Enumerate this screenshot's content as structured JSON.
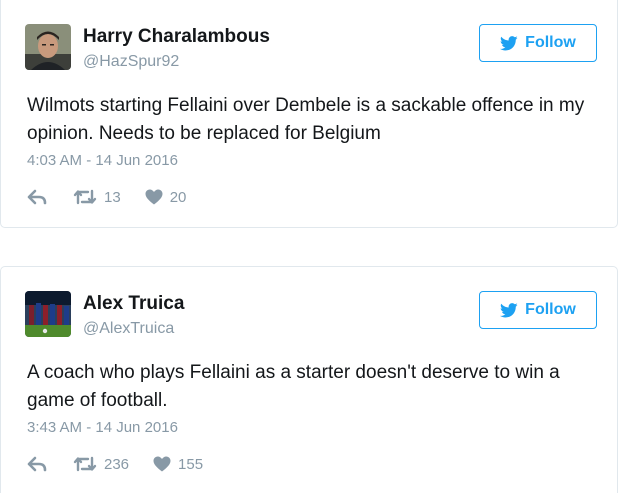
{
  "tweets": [
    {
      "name": "Harry Charalambous",
      "handle": "@HazSpur92",
      "follow_label": "Follow",
      "text": "Wilmots starting Fellaini over Dembele is a sackable offence in my opinion. Needs to be replaced for Belgium",
      "timestamp": "4:03 AM - 14 Jun 2016",
      "retweets": "13",
      "likes": "20",
      "avatar_icon": "profile-photo"
    },
    {
      "name": "Alex Truica",
      "handle": "@AlexTruica",
      "follow_label": "Follow",
      "text": "A coach who plays Fellaini as a starter doesn't deserve to win a game of football.",
      "timestamp": "3:43 AM - 14 Jun 2016",
      "retweets": "236",
      "likes": "155",
      "avatar_icon": "football-team-photo"
    }
  ],
  "colors": {
    "accent": "#1da1f2",
    "muted": "#8899a6",
    "text": "#14171a",
    "border": "#e1e8ed"
  }
}
